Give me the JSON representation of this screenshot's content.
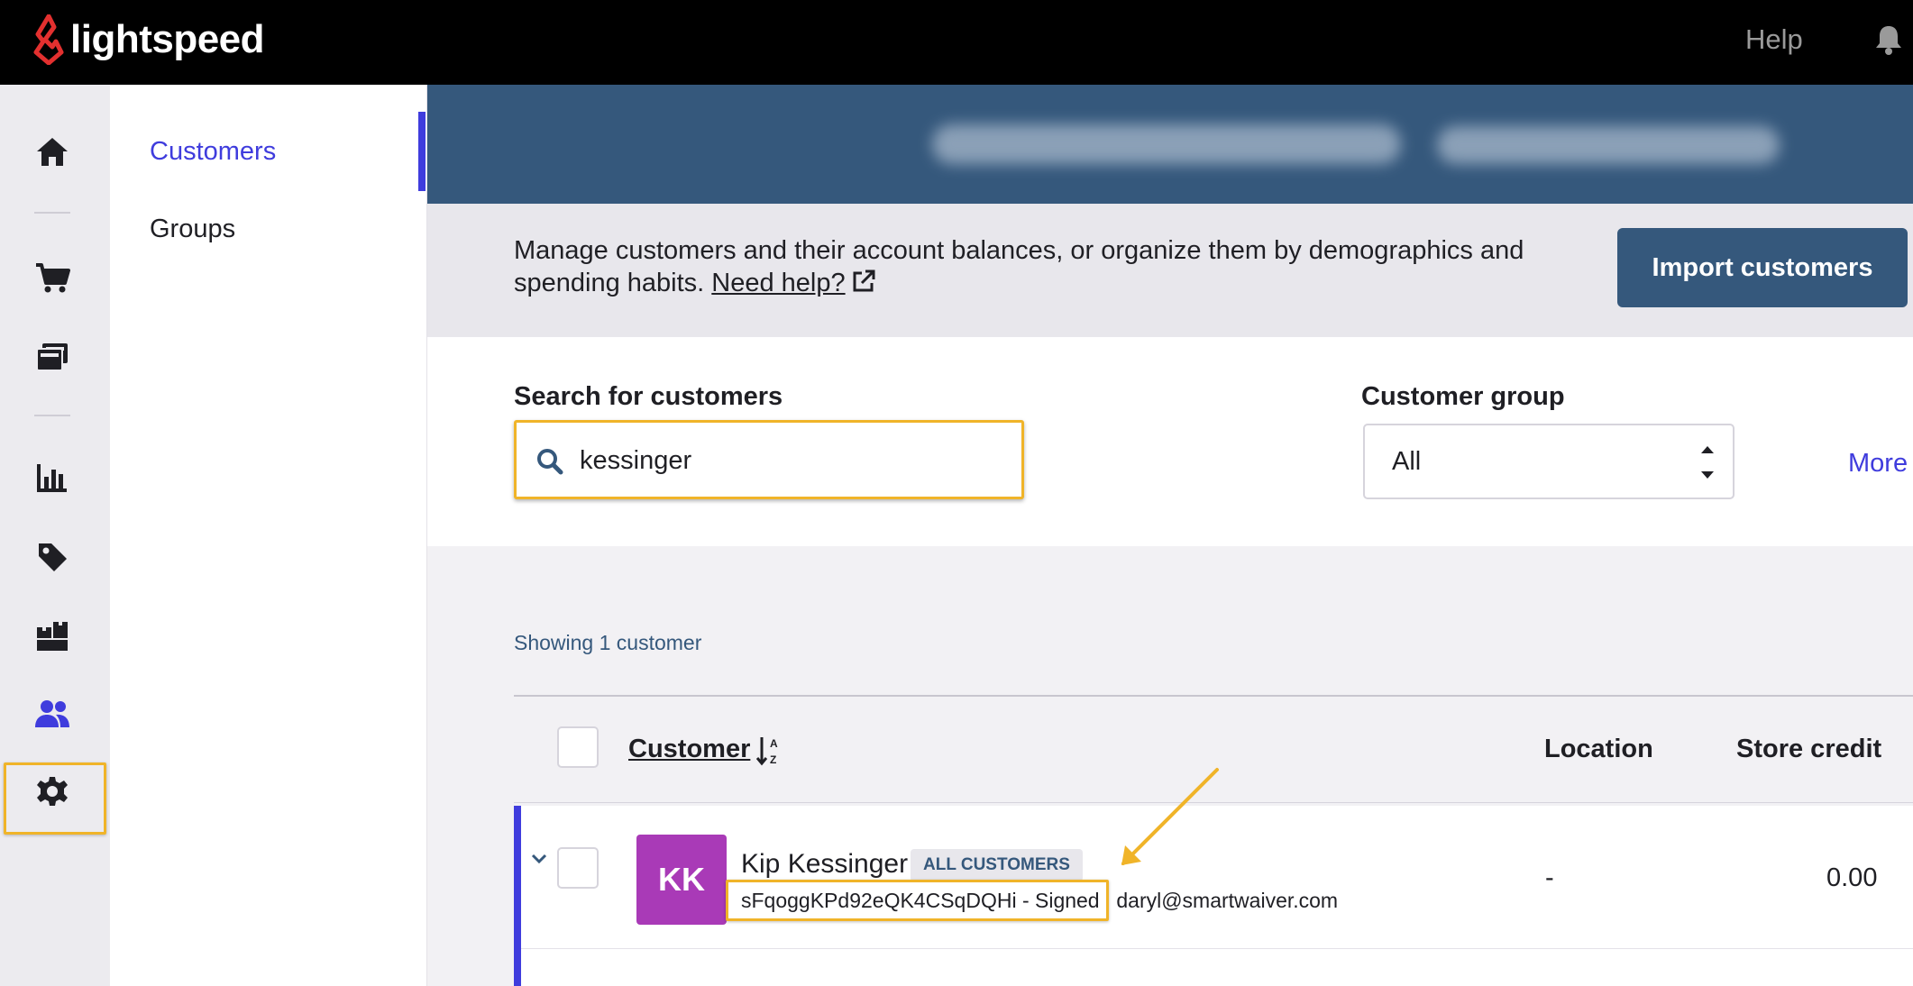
{
  "topbar": {
    "brand": "lightspeed",
    "help_label": "Help",
    "icons": [
      "lightspeed-flame-icon",
      "bell-icon"
    ]
  },
  "rail": {
    "items": [
      "home-icon",
      "cart-icon",
      "register-icon",
      "reports-icon",
      "tag-icon",
      "inventory-icon",
      "customers-icon",
      "settings-icon"
    ],
    "active": "customers-icon"
  },
  "subnav": {
    "items": [
      {
        "label": "Customers",
        "active": true
      },
      {
        "label": "Groups",
        "active": false
      }
    ]
  },
  "header": {
    "description": "Manage customers and their account balances, or organize them by demographics and spending habits.",
    "help_link": "Need help?",
    "import_button": "Import customers"
  },
  "filters": {
    "search_label": "Search for customers",
    "search_value": "kessinger",
    "group_label": "Customer group",
    "group_value": "All",
    "more_label": "More"
  },
  "results": {
    "count_text": "Showing 1 customer",
    "columns": {
      "customer": "Customer",
      "location": "Location",
      "store_credit": "Store credit"
    },
    "rows": [
      {
        "initials": "KK",
        "name": "Kip Kessinger",
        "badge": "ALL CUSTOMERS",
        "subtitle": "sFqoggKPd92eQK4CSqDQHi - Signed | daryl@smartwaiver.com",
        "location": "-",
        "store_credit": "0.00"
      }
    ]
  },
  "colors": {
    "accent": "#3f3cdd",
    "brand_blue": "#35587c",
    "highlight": "#f0b429",
    "avatar": "#a93ab7",
    "logo_red": "#e3302f"
  }
}
